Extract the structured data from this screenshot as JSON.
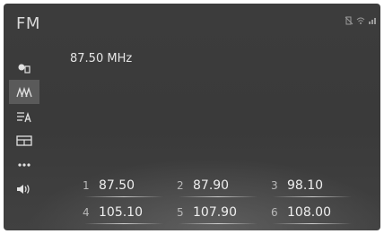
{
  "header": {
    "title": "FM",
    "status_icons": [
      "no-phone-icon",
      "wifi-icon",
      "signal-icon"
    ]
  },
  "sidebar": {
    "items": [
      {
        "name": "source-icon",
        "glyph": "●▯",
        "active": false
      },
      {
        "name": "stations-icon",
        "glyph": "ᴧᴧᴧ",
        "active": true
      },
      {
        "name": "list-icon",
        "glyph": "≡A",
        "active": false
      },
      {
        "name": "browse-icon",
        "glyph": "▭",
        "active": false
      },
      {
        "name": "more-icon",
        "glyph": "•••",
        "active": false
      },
      {
        "name": "sound-icon",
        "glyph": "◀))",
        "active": false
      }
    ]
  },
  "main": {
    "frequency": "87.50 MHz"
  },
  "presets": [
    {
      "num": "1",
      "value": "87.50"
    },
    {
      "num": "2",
      "value": "87.90"
    },
    {
      "num": "3",
      "value": "98.10"
    },
    {
      "num": "4",
      "value": "105.10"
    },
    {
      "num": "5",
      "value": "107.90"
    },
    {
      "num": "6",
      "value": "108.00"
    }
  ]
}
